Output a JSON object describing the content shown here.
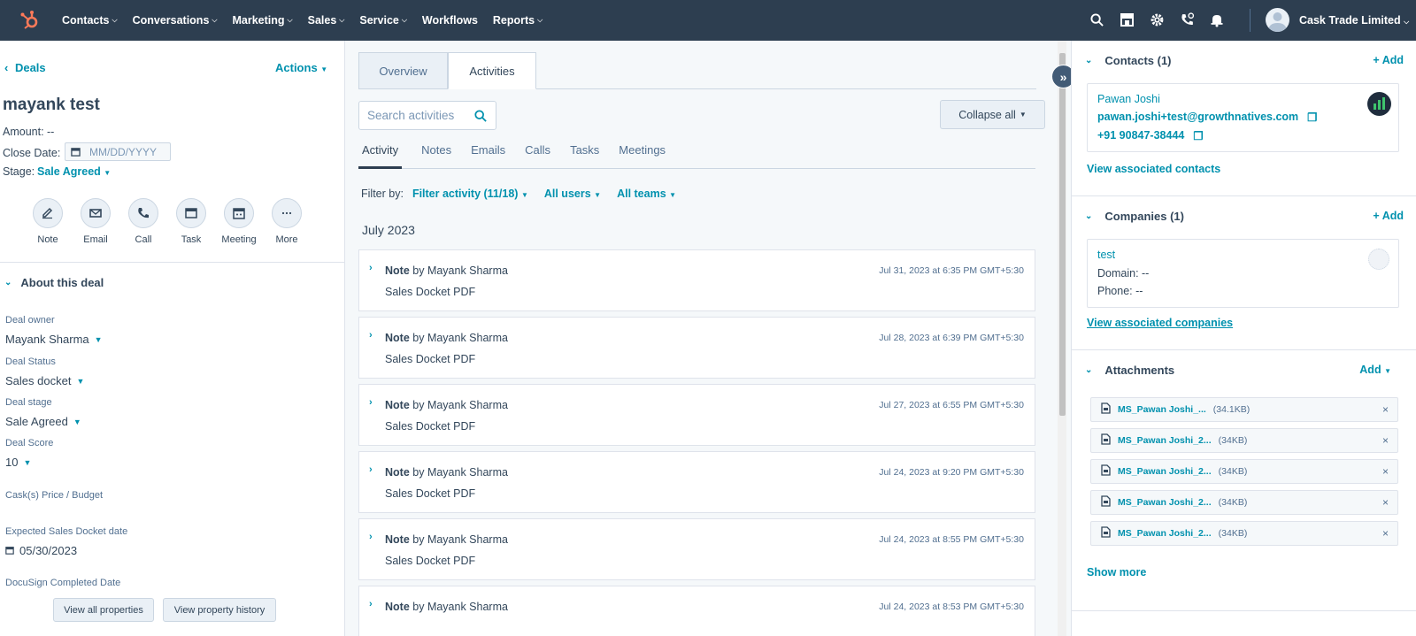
{
  "topnav": {
    "menu": [
      "Contacts",
      "Conversations",
      "Marketing",
      "Sales",
      "Service",
      "Workflows",
      "Reports"
    ],
    "menu_has_chevron": [
      true,
      true,
      true,
      true,
      true,
      false,
      true
    ],
    "account": "Cask Trade Limited"
  },
  "left": {
    "back": "Deals",
    "actions": "Actions",
    "title": "mayank test",
    "amount": "Amount: --",
    "close_label": "Close Date:",
    "close_placeholder": "MM/DD/YYYY",
    "stage_label": "Stage:",
    "stage_value": "Sale Agreed",
    "action_buttons": [
      "Note",
      "Email",
      "Call",
      "Task",
      "Meeting",
      "More"
    ],
    "about": "About this deal",
    "props": [
      {
        "label": "Deal owner",
        "value": "Mayank Sharma"
      },
      {
        "label": "Deal Status",
        "value": "Sales docket"
      },
      {
        "label": "Deal stage",
        "value": "Sale Agreed"
      },
      {
        "label": "Deal Score",
        "value": "10"
      },
      {
        "label": "Cask(s) Price / Budget",
        "value": ""
      },
      {
        "label": "Expected Sales Docket date",
        "value": "05/30/2023"
      },
      {
        "label": "DocuSign Completed Date",
        "value": ""
      }
    ],
    "view_all": "View all properties",
    "view_history": "View property history"
  },
  "mid": {
    "tabs": [
      "Overview",
      "Activities"
    ],
    "search_placeholder": "Search activities",
    "collapse_all": "Collapse all",
    "subtabs": [
      "Activity",
      "Notes",
      "Emails",
      "Calls",
      "Tasks",
      "Meetings"
    ],
    "filter_by": "Filter by:",
    "filter_activity": "Filter activity (11/18)",
    "all_users": "All users",
    "all_teams": "All teams",
    "month": "July 2023",
    "notes": [
      {
        "type": "Note",
        "by": "by Mayank Sharma",
        "body": "Sales Docket PDF",
        "time": "Jul 31, 2023 at 6:35 PM GMT+5:30"
      },
      {
        "type": "Note",
        "by": "by Mayank Sharma",
        "body": "Sales Docket PDF",
        "time": "Jul 28, 2023 at 6:39 PM GMT+5:30"
      },
      {
        "type": "Note",
        "by": "by Mayank Sharma",
        "body": "Sales Docket PDF",
        "time": "Jul 27, 2023 at 6:55 PM GMT+5:30"
      },
      {
        "type": "Note",
        "by": "by Mayank Sharma",
        "body": "Sales Docket PDF",
        "time": "Jul 24, 2023 at 9:20 PM GMT+5:30"
      },
      {
        "type": "Note",
        "by": "by Mayank Sharma",
        "body": "Sales Docket PDF",
        "time": "Jul 24, 2023 at 8:55 PM GMT+5:30"
      },
      {
        "type": "Note",
        "by": "by Mayank Sharma",
        "body": "",
        "time": "Jul 24, 2023 at 8:53 PM GMT+5:30"
      }
    ]
  },
  "right": {
    "contacts": {
      "title": "Contacts (1)",
      "add": "+ Add",
      "name": "Pawan Joshi",
      "email": "pawan.joshi+test@growthnatives.com",
      "phone": "+91 90847-38444",
      "view": "View associated contacts"
    },
    "companies": {
      "title": "Companies (1)",
      "add": "+ Add",
      "name": "test",
      "domain": "Domain: --",
      "phone": "Phone: --",
      "view": "View associated companies"
    },
    "attachments": {
      "title": "Attachments",
      "add": "Add",
      "files": [
        {
          "name": "MS_Pawan Joshi_...",
          "size": "(34.1KB)"
        },
        {
          "name": "MS_Pawan Joshi_2...",
          "size": "(34KB)"
        },
        {
          "name": "MS_Pawan Joshi_2...",
          "size": "(34KB)"
        },
        {
          "name": "MS_Pawan Joshi_2...",
          "size": "(34KB)"
        },
        {
          "name": "MS_Pawan Joshi_2...",
          "size": "(34KB)"
        }
      ],
      "show_more": "Show more"
    }
  },
  "colors": {
    "nav": "#2d3e50",
    "link": "#0091ae",
    "text": "#33475b",
    "hubspot_orange": "#ff7a59"
  }
}
